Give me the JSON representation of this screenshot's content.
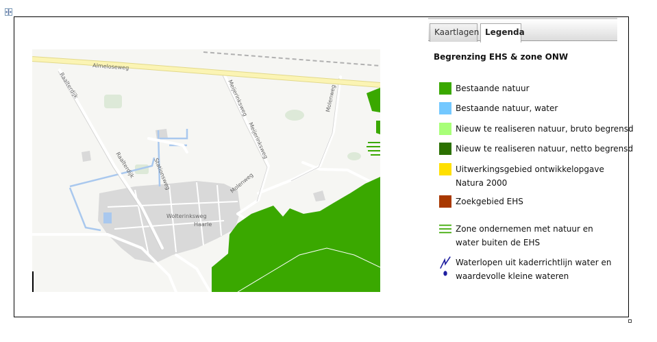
{
  "tabs": [
    {
      "label": "Kaartlagen",
      "active": false
    },
    {
      "label": "Legenda",
      "active": true
    }
  ],
  "legend": {
    "title": "Begrenzing EHS & zone ONW",
    "items": [
      {
        "label": "Bestaande natuur",
        "color": "#3aa800",
        "symbol": "square"
      },
      {
        "label": "Bestaande natuur, water",
        "color": "#73c8ff",
        "symbol": "square"
      },
      {
        "label": "Nieuw te realiseren natuur, bruto begrensd",
        "color": "#a8ff78",
        "symbol": "square"
      },
      {
        "label": "Nieuw te realiseren natuur, netto begrensd",
        "color": "#2b7000",
        "symbol": "square"
      },
      {
        "label": "Uitwerkingsgebied ontwikkelopgave Natura 2000",
        "color": "#ffe000",
        "symbol": "square"
      },
      {
        "label": "Zoekgebied EHS",
        "color": "#a83800",
        "symbol": "square"
      },
      {
        "label": "Zone ondernemen met natuur en water buiten de EHS",
        "color": "#3aa800",
        "symbol": "hatch-lines"
      },
      {
        "label": "Waterlopen uit kaderrichtlijn water en waardevolle kleine wateren",
        "color": "#1e1ea0",
        "symbol": "line-and-dot"
      }
    ]
  },
  "map": {
    "road_labels": {
      "almeloseweg": "Almeloseweg",
      "raalterdijk_1": "Raalterdijk",
      "raalterdijk_2": "Raalterdijk",
      "meijerinksweg_1": "Meijerinksweg",
      "meijerinksweg_2": "Meijerinksweg",
      "molenweg_1": "Molenweg",
      "molenweg_2": "Molenweg",
      "stationsweg": "Stationsweg",
      "wolterinksweg": "Wolterinksweg",
      "haarle": "Haarle"
    },
    "colors": {
      "background": "#f6f6f3",
      "main_road": "#fbf4b4",
      "nature": "#3aa800",
      "water": "#a9c8ee",
      "built_up": "#d9d9d9"
    }
  }
}
